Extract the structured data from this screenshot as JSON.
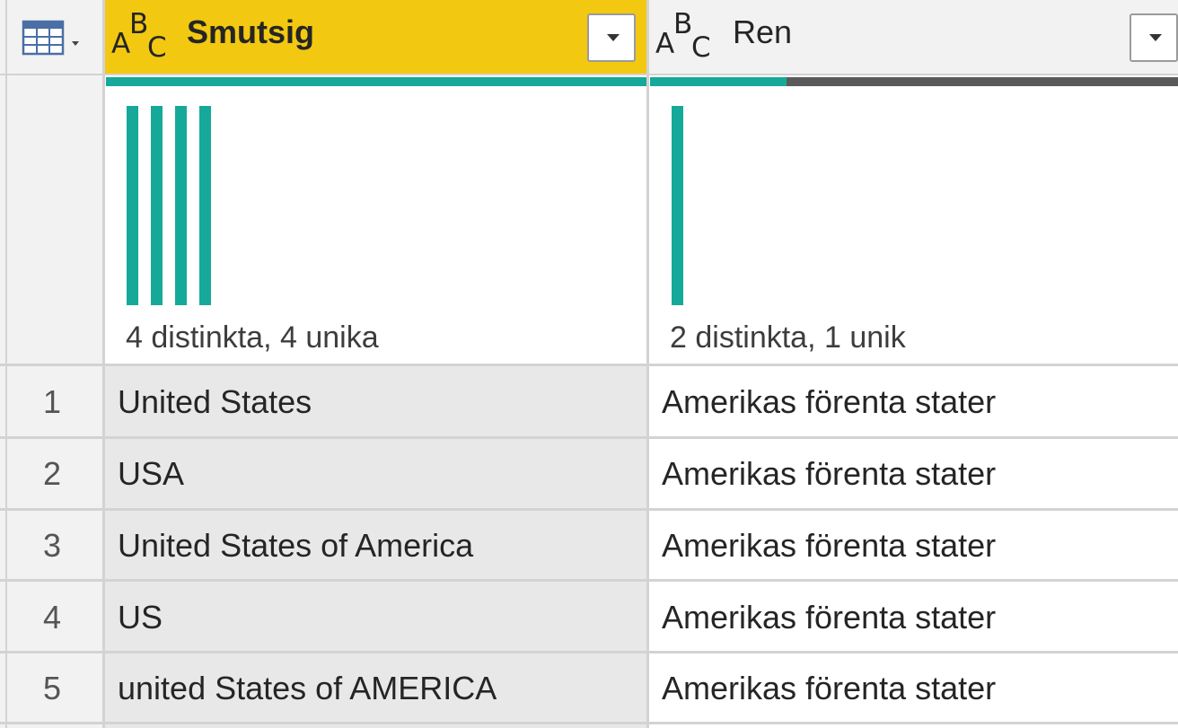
{
  "table": {
    "columns": [
      {
        "type_icon": "abc-text-type-icon",
        "type_glyphs": [
          "A",
          "B",
          "C"
        ],
        "name": "Smutsig",
        "distinct_summary": "4 distinkta, 4 unika",
        "distinct_bar_count": 4,
        "valid_fraction": 1.0
      },
      {
        "type_icon": "abc-text-type-icon",
        "type_glyphs": [
          "A",
          "B",
          "C"
        ],
        "name": "Ren",
        "distinct_summary": "2 distinkta, 1 unik",
        "distinct_bar_count": 1,
        "valid_fraction": 0.26
      }
    ],
    "rows": [
      {
        "num": "1",
        "cells": [
          "United States",
          "Amerikas förenta stater"
        ]
      },
      {
        "num": "2",
        "cells": [
          "USA",
          "Amerikas förenta stater"
        ]
      },
      {
        "num": "3",
        "cells": [
          "United States of America",
          "Amerikas förenta stater"
        ]
      },
      {
        "num": "4",
        "cells": [
          "US",
          "Amerikas förenta stater"
        ]
      },
      {
        "num": "5",
        "cells": [
          "united States of AMERICA",
          "Amerikas förenta stater"
        ]
      }
    ]
  },
  "colors": {
    "selected_header": "#f2c811",
    "valid": "#16a999",
    "empty": "#5a5a5a",
    "selected_column_bg": "#e8e8e8"
  },
  "icons": {
    "table_menu": "table-grid-icon",
    "dropdown": "chevron-down-icon"
  }
}
